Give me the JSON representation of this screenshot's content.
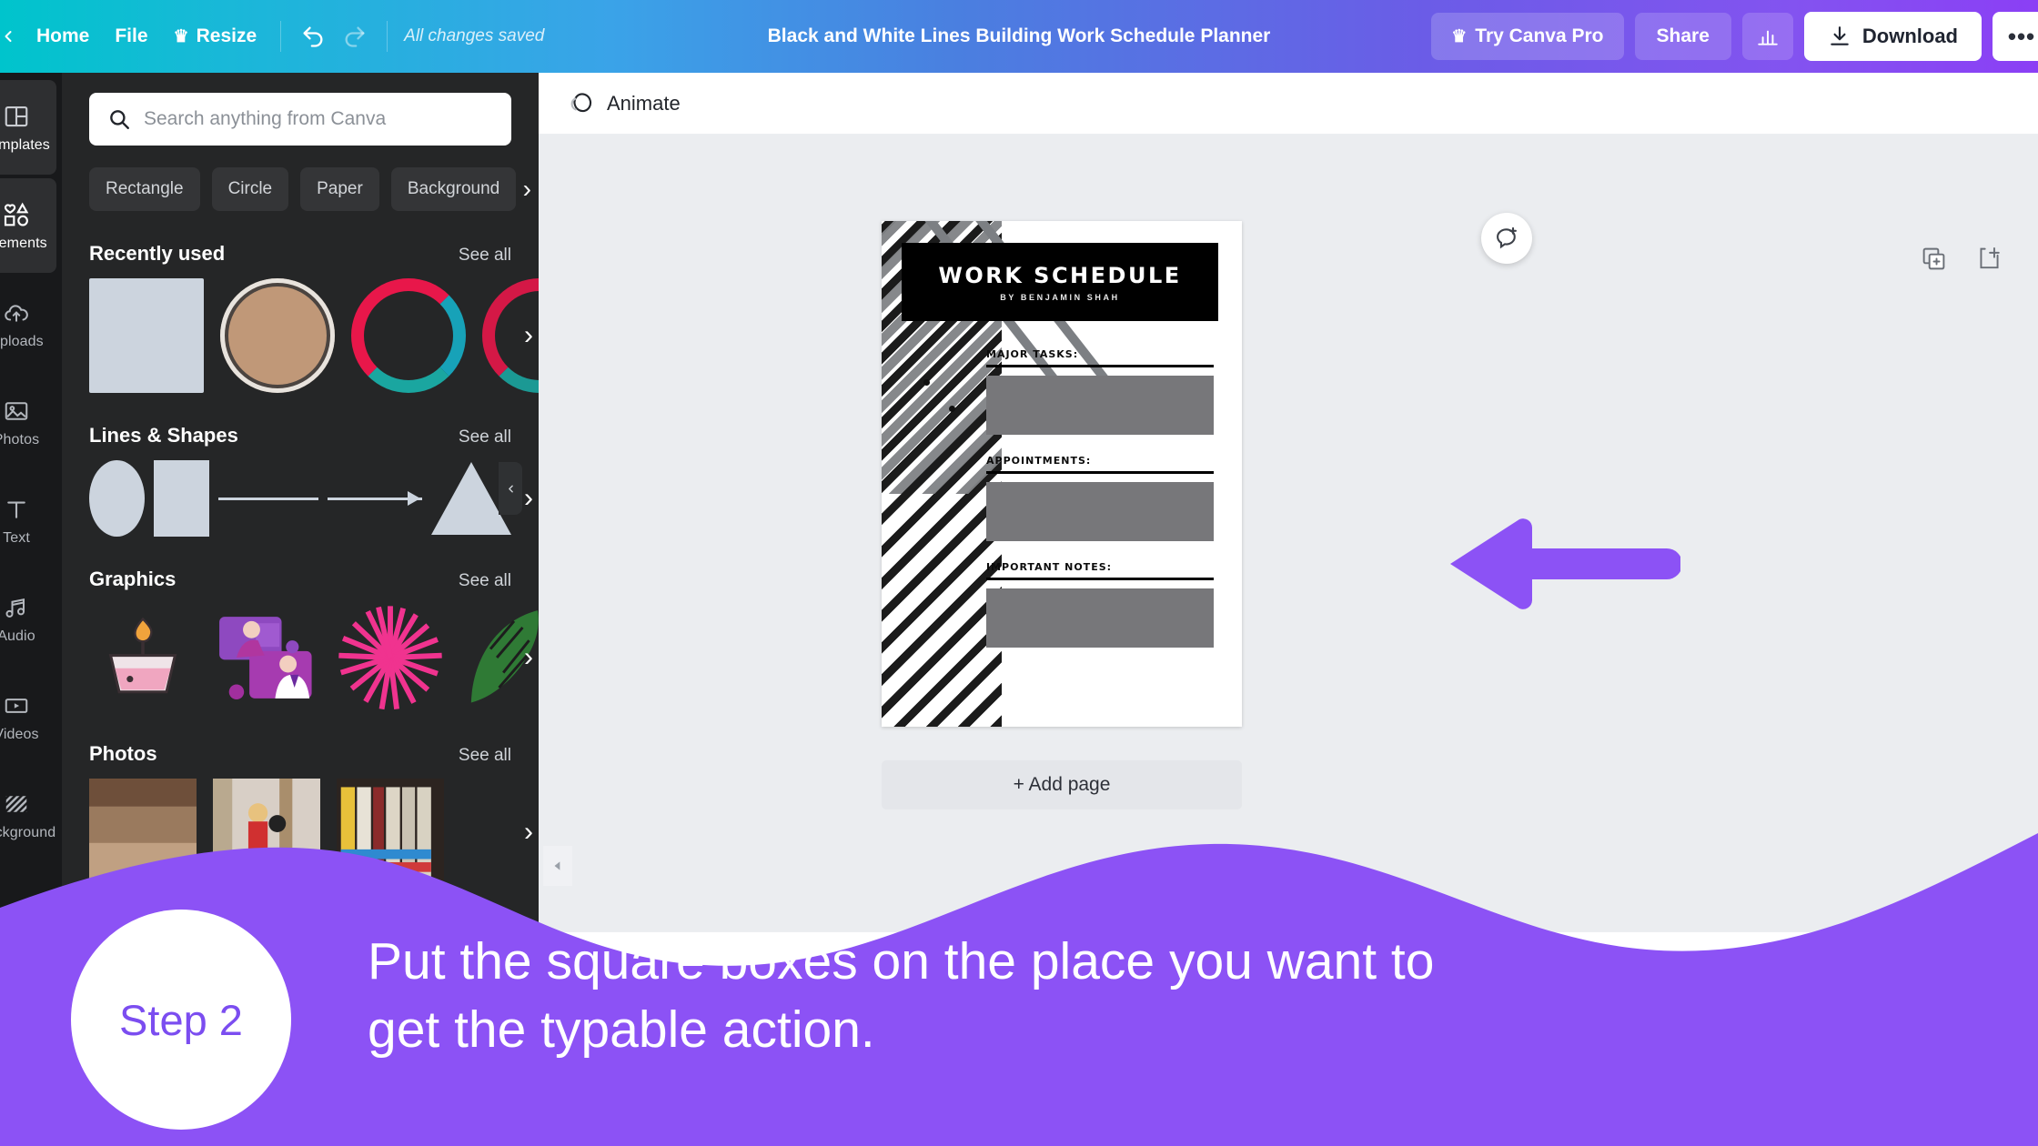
{
  "topbar": {
    "back_icon": "chevron-left-icon",
    "home_label": "Home",
    "file_label": "File",
    "resize_label": "Resize",
    "resize_crown_icon": "crown-icon",
    "undo_icon": "undo-icon",
    "redo_icon": "redo-icon",
    "save_status": "All changes saved",
    "design_title": "Black and White Lines Building Work Schedule Planner",
    "try_pro_label": "Try Canva Pro",
    "try_pro_icon": "crown-icon",
    "share_label": "Share",
    "stats_icon": "bar-chart-icon",
    "download_label": "Download",
    "download_icon": "download-icon",
    "more_label": "•••",
    "accent_start": "#00c4cc",
    "accent_end": "#8b3ff5"
  },
  "rail": {
    "items": [
      {
        "label": "Templates",
        "icon": "templates-icon",
        "active": true
      },
      {
        "label": "Elements",
        "icon": "elements-icon",
        "active": true
      },
      {
        "label": "Uploads",
        "icon": "upload-cloud-icon",
        "active": false
      },
      {
        "label": "Photos",
        "icon": "photo-icon",
        "active": false
      },
      {
        "label": "Text",
        "icon": "text-icon",
        "active": false
      },
      {
        "label": "Audio",
        "icon": "audio-note-icon",
        "active": false
      },
      {
        "label": "Videos",
        "icon": "video-icon",
        "active": false
      },
      {
        "label": "Background",
        "icon": "background-pattern-icon",
        "active": false
      }
    ]
  },
  "panel": {
    "search": {
      "placeholder": "Search anything from Canva",
      "value": "",
      "icon": "search-icon"
    },
    "chips": [
      "Rectangle",
      "Circle",
      "Paper",
      "Background"
    ],
    "chips_next_icon": "chevron-right-icon",
    "sections": [
      {
        "title": "Recently used",
        "see_all": "See all"
      },
      {
        "title": "Lines & Shapes",
        "see_all": "See all"
      },
      {
        "title": "Graphics",
        "see_all": "See all"
      },
      {
        "title": "Photos",
        "see_all": "See all"
      }
    ],
    "collapse_icon": "chevron-left-icon",
    "shapes": [
      "circle",
      "square",
      "line",
      "arrow",
      "triangle"
    ]
  },
  "editor": {
    "animate_label": "Animate",
    "animate_icon": "animate-icon",
    "duplicate_page_icon": "duplicate-page-icon",
    "add_page_icon": "add-page-icon",
    "comment_icon": "add-comment-icon",
    "add_page_label": "+ Add page",
    "notes_icon": "notes-icon",
    "collapse_panel_icon": "chevron-left-icon"
  },
  "document": {
    "title": "WORK SCHEDULE",
    "subtitle": "BY BENJAMIN SHAH",
    "fields": [
      {
        "label": "MAJOR TASKS:"
      },
      {
        "label": "APPOINTMENTS:"
      },
      {
        "label": "IMPORTANT NOTES:"
      }
    ]
  },
  "annotation": {
    "arrow_color": "#8c52f5",
    "arrow_direction": "left",
    "step_label": "Step 2",
    "instruction_line1": "Put the square boxes on the place you want to",
    "instruction_line2": "get the typable action.",
    "overlay_color": "#8c52f5"
  }
}
